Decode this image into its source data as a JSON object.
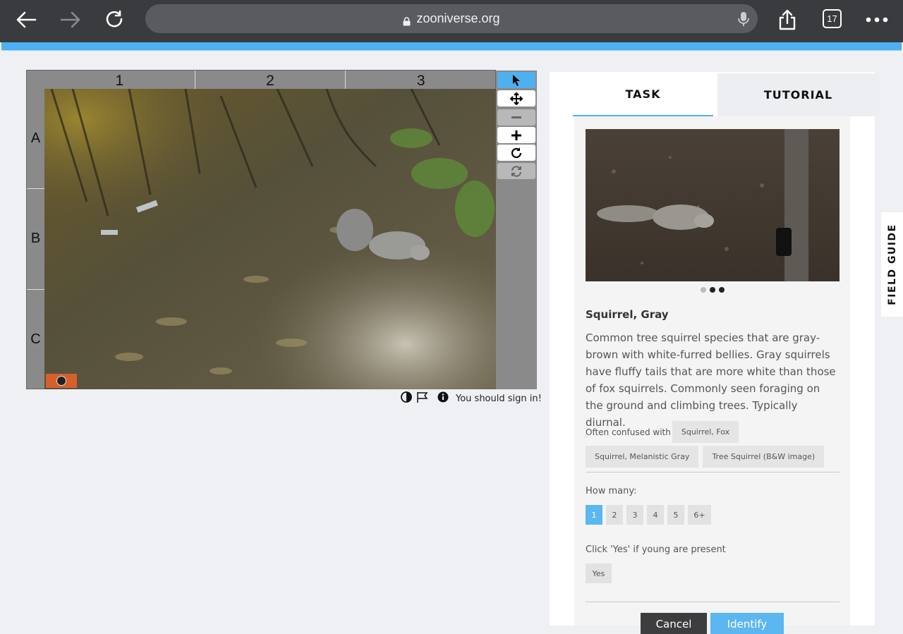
{
  "browser": {
    "url": "zooniverse.org",
    "tab_count": "17",
    "icons": [
      "back-arrow-icon",
      "forward-arrow-icon",
      "reload-icon",
      "lock-icon",
      "microphone-icon",
      "share-icon",
      "tabs-icon",
      "more-icon"
    ]
  },
  "viewer": {
    "columns": [
      "1",
      "2",
      "3"
    ],
    "rows": [
      "A",
      "B",
      "C"
    ],
    "tools": [
      "pointer-icon",
      "pan-icon",
      "zoom-out-icon",
      "zoom-in-icon",
      "rotate-icon",
      "reset-icon"
    ],
    "active_tool": "pointer-icon",
    "sign_in_text": "You should sign in!"
  },
  "panel": {
    "tabs": [
      {
        "label": "TASK",
        "active": true
      },
      {
        "label": "TUTORIAL",
        "active": false
      }
    ],
    "species": {
      "name": "Squirrel, Gray",
      "description": "Common tree squirrel species that are gray-brown with white-furred bellies. Gray squirrels have fluffy tails that are more white than those of fox squirrels. Commonly seen foraging on the ground and climbing trees. Typically diurnal.",
      "carousel_active_index": 2,
      "carousel_count": 3
    },
    "confused_label": "Often confused with",
    "confused_with": [
      "Squirrel, Fox",
      "Squirrel, Melanistic Gray",
      "Tree Squirrel (B&W image)"
    ],
    "how_many_label": "How many:",
    "how_many_options": [
      "1",
      "2",
      "3",
      "4",
      "5",
      "6+"
    ],
    "how_many_selected": "1",
    "young_label": "Click 'Yes' if young are present",
    "young_option": "Yes",
    "cancel_label": "Cancel",
    "identify_label": "Identify"
  },
  "field_guide_label": "FIELD GUIDE",
  "colors": {
    "accent": "#4fb0f0",
    "chrome": "#3a3b3f",
    "cancel": "#3d3d3f"
  }
}
